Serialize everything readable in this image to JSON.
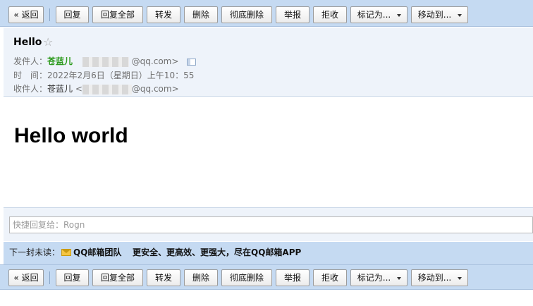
{
  "toolbar": {
    "back": "« 返回",
    "reply": "回复",
    "reply_all": "回复全部",
    "forward": "转发",
    "delete": "删除",
    "delete_permanent": "彻底删除",
    "report": "举报",
    "reject": "拒收",
    "mark_as": "标记为...",
    "move_to": "移动到..."
  },
  "email": {
    "subject": "Hello",
    "star": "☆",
    "from_label": "发件人：",
    "from_name": "苍蓝儿",
    "from_address_suffix": "@qq.com>",
    "time_label": "时　间：",
    "time_value": "2022年2月6日（星期日）上午10：55",
    "to_label": "收件人：",
    "to_name": "苍蓝儿",
    "to_address_prefix": "<",
    "to_address_suffix": "@qq.com>",
    "body_heading": "Hello world"
  },
  "quick_reply": {
    "placeholder": "快捷回复给：Rogn"
  },
  "next_unread": {
    "label": "下一封未读：",
    "sender": "QQ邮箱团队",
    "subject": "更安全、更高效、更强大，尽在QQ邮箱APP"
  }
}
